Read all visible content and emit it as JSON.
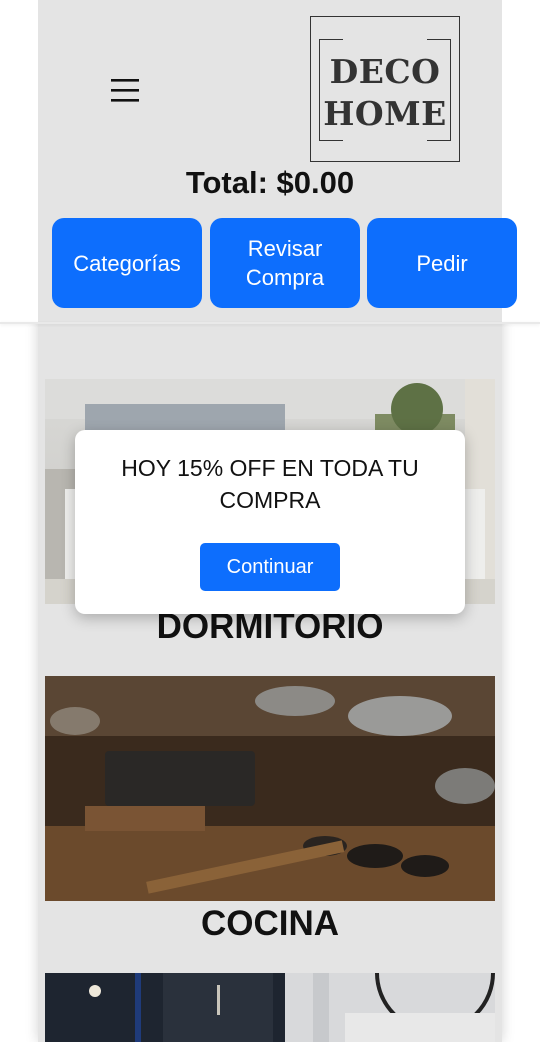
{
  "header": {
    "menu_icon": "hamburger-menu-icon",
    "logo": {
      "line1": "DECO",
      "line2": "HOME"
    },
    "total_label": "Total: $0.00",
    "buttons": [
      {
        "label": "Categorías"
      },
      {
        "label_line1": "Revisar",
        "label_line2": "Compra"
      },
      {
        "label": "Pedir"
      }
    ]
  },
  "categories": [
    {
      "title": "DORMITORIO"
    },
    {
      "title": "COCINA"
    }
  ],
  "modal": {
    "message": "HOY 15% OFF EN TODA TU COMPRA",
    "button_label": "Continuar"
  },
  "colors": {
    "primary": "#0d6efd",
    "column_background": "#e4e4e4",
    "text": "#111111"
  }
}
